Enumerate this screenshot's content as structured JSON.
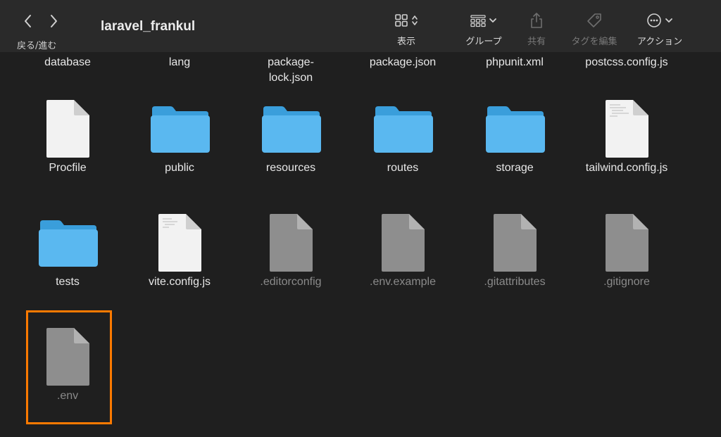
{
  "toolbar": {
    "nav_label": "戻る/進む",
    "title": "laravel_frankul",
    "view_label": "表示",
    "group_label": "グループ",
    "share_label": "共有",
    "tags_label": "タグを編集",
    "action_label": "アクション"
  },
  "files": {
    "row0": [
      "database",
      "lang",
      "package-lock.json",
      "package.json",
      "phpunit.xml",
      "postcss.config.js"
    ],
    "row0_pkg_lock_line1": "package-",
    "row0_pkg_lock_line2": "lock.json",
    "row1": [
      "Procfile",
      "public",
      "resources",
      "routes",
      "storage",
      "tailwind.config.js"
    ],
    "row2": [
      "tests",
      "vite.config.js",
      ".editorconfig",
      ".env.example",
      ".gitattributes",
      ".gitignore"
    ],
    "row3": [
      ".env"
    ]
  },
  "colors": {
    "highlight": "#ff7a00",
    "folder": "#5ab8f0",
    "doc_white": "#f2f2f2",
    "doc_gray": "#8e8e8e"
  }
}
